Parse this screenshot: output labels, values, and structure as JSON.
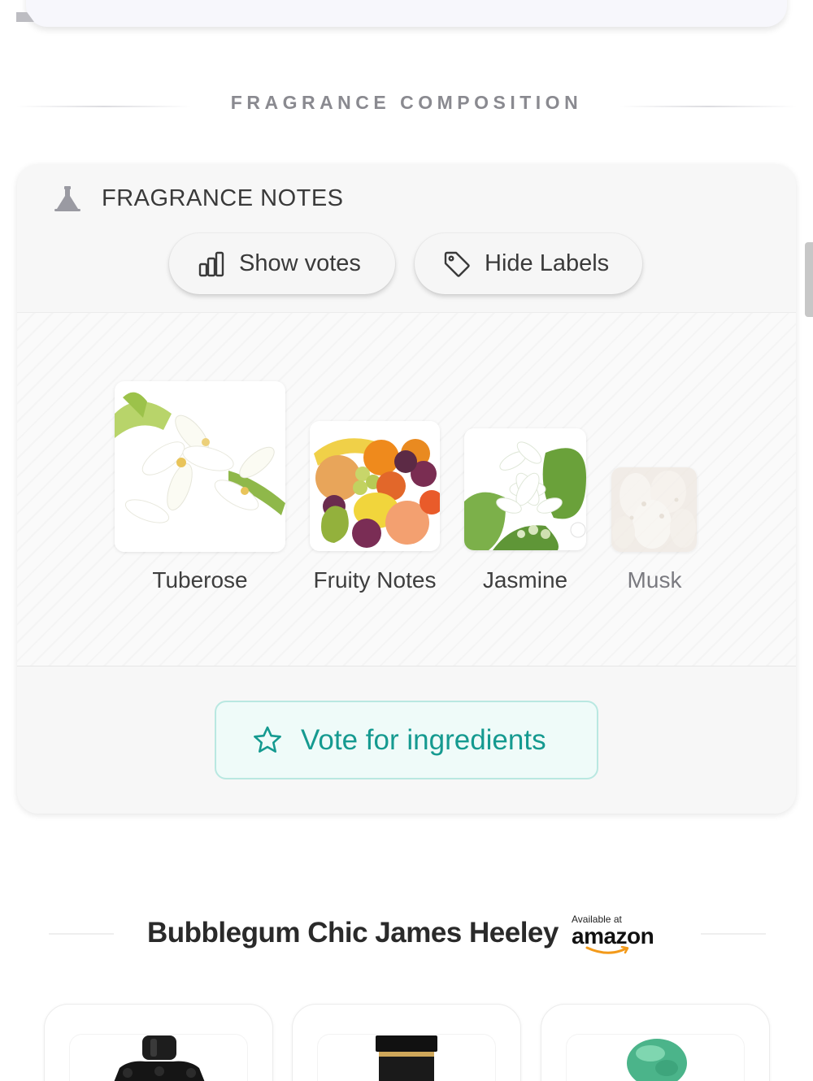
{
  "section": {
    "title": "FRAGRANCE COMPOSITION"
  },
  "notes_card": {
    "title": "FRAGRANCE NOTES",
    "show_votes_label": "Show votes",
    "hide_labels_label": "Hide Labels",
    "notes": [
      {
        "label": "Tuberose",
        "icon": "tuberose-flower-photo"
      },
      {
        "label": "Fruity Notes",
        "icon": "fruit-basket-photo"
      },
      {
        "label": "Jasmine",
        "icon": "jasmine-flower-photo"
      },
      {
        "label": "Musk",
        "icon": "musk-texture-photo"
      }
    ],
    "vote_label": "Vote for ingredients"
  },
  "brand": {
    "title": "Bubblegum Chic James Heeley",
    "amazon_small": "Available at",
    "amazon_word": "amazon"
  },
  "colors": {
    "accent_teal": "#159a90",
    "vote_bg": "#effbf9",
    "card_bg": "#f7f7f7"
  }
}
